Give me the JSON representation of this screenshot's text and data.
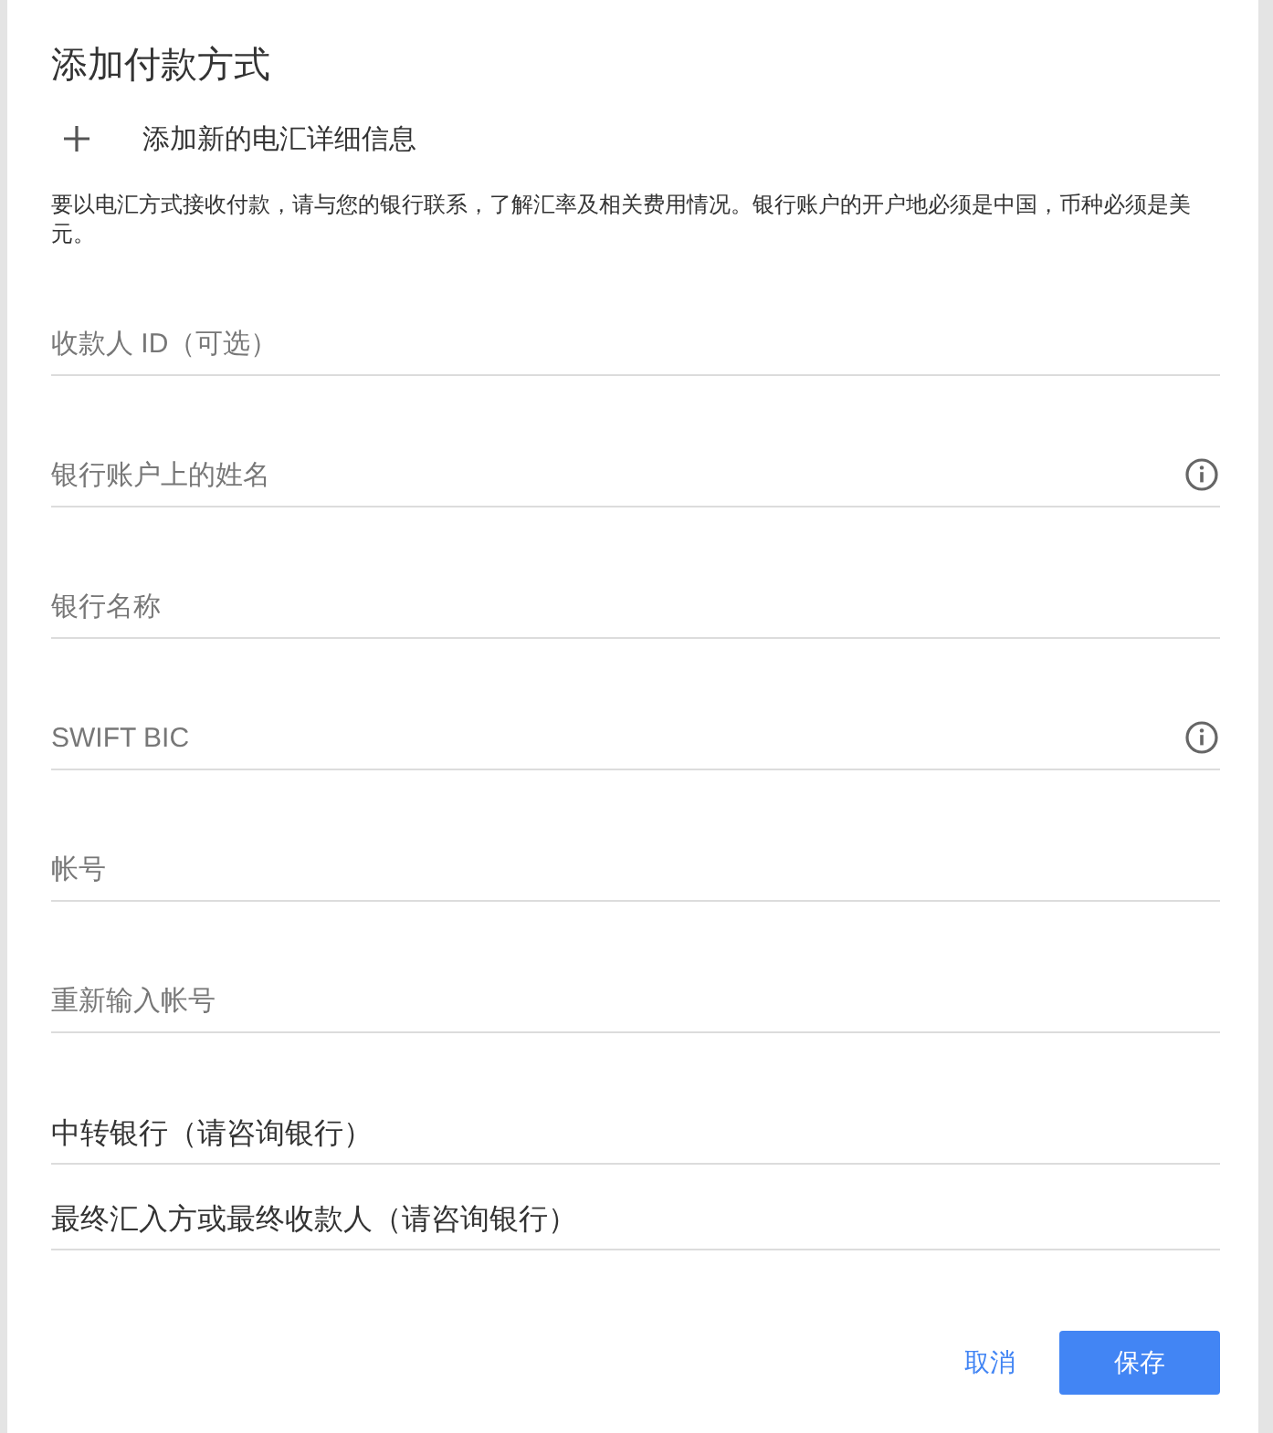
{
  "dialog": {
    "title": "添加付款方式"
  },
  "add_action": {
    "label": "添加新的电汇详细信息"
  },
  "notice": "要以电汇方式接收付款，请与您的银行联系，了解汇率及相关费用情况。银行账户的开户地必须是中国，币种必须是美元。",
  "fields": [
    {
      "placeholder": "收款人 ID（可选）",
      "has_info": false
    },
    {
      "placeholder": "银行账户上的姓名",
      "has_info": true
    },
    {
      "placeholder": "银行名称",
      "has_info": false
    },
    {
      "placeholder": "SWIFT BIC",
      "has_info": true
    },
    {
      "placeholder": "帐号",
      "has_info": false
    },
    {
      "placeholder": "重新输入帐号",
      "has_info": false
    }
  ],
  "sections": [
    {
      "label": "中转银行（请咨询银行）"
    },
    {
      "label": "最终汇入方或最终收款人（请咨询银行）"
    }
  ],
  "buttons": [
    {
      "label": "取消",
      "kind": "text"
    },
    {
      "label": "保存",
      "kind": "primary"
    }
  ]
}
